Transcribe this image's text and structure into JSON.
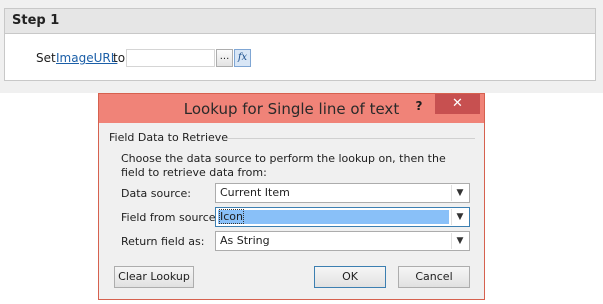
{
  "step": {
    "title": "Step 1",
    "set_label": "Set",
    "field_link": "ImageURL",
    "to_label": "to",
    "value": "",
    "dots_label": "...",
    "fx_label": "fx"
  },
  "dialog": {
    "title": "Lookup for Single line of text",
    "help_label": "?",
    "close_label": "✕",
    "group_label": "Field Data to Retrieve",
    "description": "Choose the data source to perform the lookup on, then the field to retrieve data from:",
    "rows": [
      {
        "label": "Data source:",
        "value": "Current Item"
      },
      {
        "label": "Field from source:",
        "value": "Icon"
      },
      {
        "label": "Return field as:",
        "value": "As String"
      }
    ],
    "buttons": {
      "clear": "Clear Lookup",
      "ok": "OK",
      "cancel": "Cancel"
    }
  },
  "colors": {
    "titlebar": "#f08378",
    "close_button": "#c75050",
    "link": "#1b5fa8",
    "selection": "#89c0f8"
  },
  "icons": {
    "dropdown": "chevron-down-icon",
    "close": "close-icon",
    "help": "help-icon",
    "formula": "fx-icon"
  }
}
